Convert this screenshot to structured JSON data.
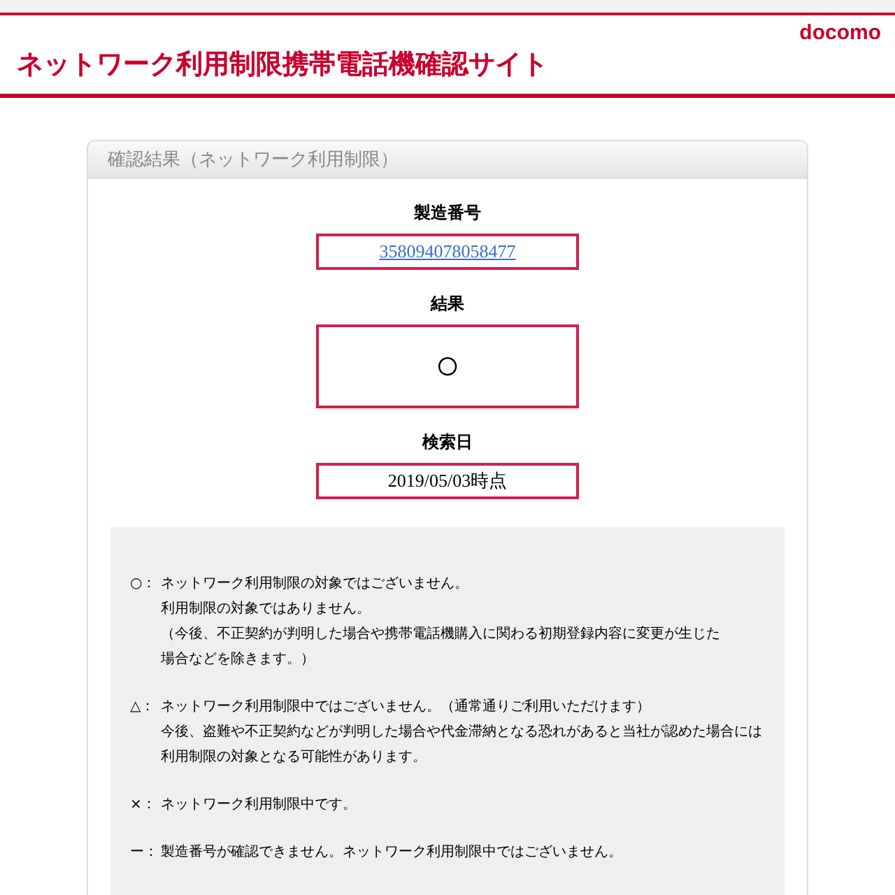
{
  "header": {
    "title": "ネットワーク利用制限携帯電話機確認サイト",
    "logo": "docomo"
  },
  "panel": {
    "title": "確認結果（ネットワーク利用制限）",
    "fields": [
      {
        "kind": "link",
        "label": "製造番号",
        "value": "358094078058477"
      },
      {
        "kind": "symbol",
        "label": "結果",
        "value": "○"
      },
      {
        "kind": "text",
        "label": "検索日",
        "value": "2019/05/03時点"
      }
    ],
    "legend": [
      {
        "mark": "○：",
        "lines": [
          "ネットワーク利用制限の対象ではございません。",
          "利用制限の対象ではありません。",
          "（今後、不正契約が判明した場合や携帯電話機購入に関わる初期登録内容に変更が生じた",
          "場合などを除きます。）"
        ]
      },
      {
        "mark": "△：",
        "lines": [
          "ネットワーク利用制限中ではございません。（通常通りご利用いただけます）",
          "今後、盗難や不正契約などが判明した場合や代金滞納となる恐れがあると当社が認めた場合には",
          "利用制限の対象となる可能性があります。"
        ]
      },
      {
        "mark": "×：",
        "lines": [
          "ネットワーク利用制限中です。"
        ]
      },
      {
        "mark": "ー：",
        "lines": [
          "製造番号が確認できません。ネットワーク利用制限中ではございません。"
        ]
      }
    ]
  }
}
